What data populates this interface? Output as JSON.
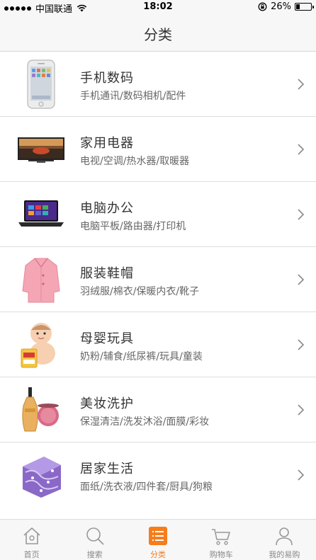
{
  "status_bar": {
    "carrier": "中国联通",
    "time": "18:02",
    "battery": "26%",
    "battery_level": 0.26,
    "icons": [
      "signal-dots-icon",
      "wifi-icon",
      "rotation-lock-icon",
      "battery-icon"
    ]
  },
  "header": {
    "title": "分类"
  },
  "categories": [
    {
      "name": "手机数码",
      "sub": "手机通讯/数码相机/配件",
      "icon": "smartphone-icon"
    },
    {
      "name": "家用电器",
      "sub": "电视/空调/热水器/取暖器",
      "icon": "television-icon"
    },
    {
      "name": "电脑办公",
      "sub": "电脑平板/路由器/打印机",
      "icon": "laptop-icon"
    },
    {
      "name": "服装鞋帽",
      "sub": "羽绒服/棉衣/保暖内衣/靴子",
      "icon": "pink-coat-icon"
    },
    {
      "name": "母婴玩具",
      "sub": "奶粉/辅食/纸尿裤/玩具/童装",
      "icon": "baby-icon"
    },
    {
      "name": "美妆洗护",
      "sub": "保湿清洁/洗发沐浴/面膜/彩妆",
      "icon": "perfume-icon"
    },
    {
      "name": "居家生活",
      "sub": "面纸/洗衣液/四件套/厨具/狗粮",
      "icon": "bedding-icon"
    }
  ],
  "tabs": [
    {
      "label": "首页",
      "icon": "home-icon",
      "active": false
    },
    {
      "label": "搜索",
      "icon": "search-icon",
      "active": false
    },
    {
      "label": "分类",
      "icon": "category-list-icon",
      "active": true
    },
    {
      "label": "购物车",
      "icon": "cart-icon",
      "active": false
    },
    {
      "label": "我的易购",
      "icon": "user-icon",
      "active": false
    }
  ],
  "colors": {
    "accent": "#f57d1c",
    "text": "#333333",
    "subtext": "#666666",
    "divider": "#dedede",
    "bar": "#f7f7f7"
  }
}
